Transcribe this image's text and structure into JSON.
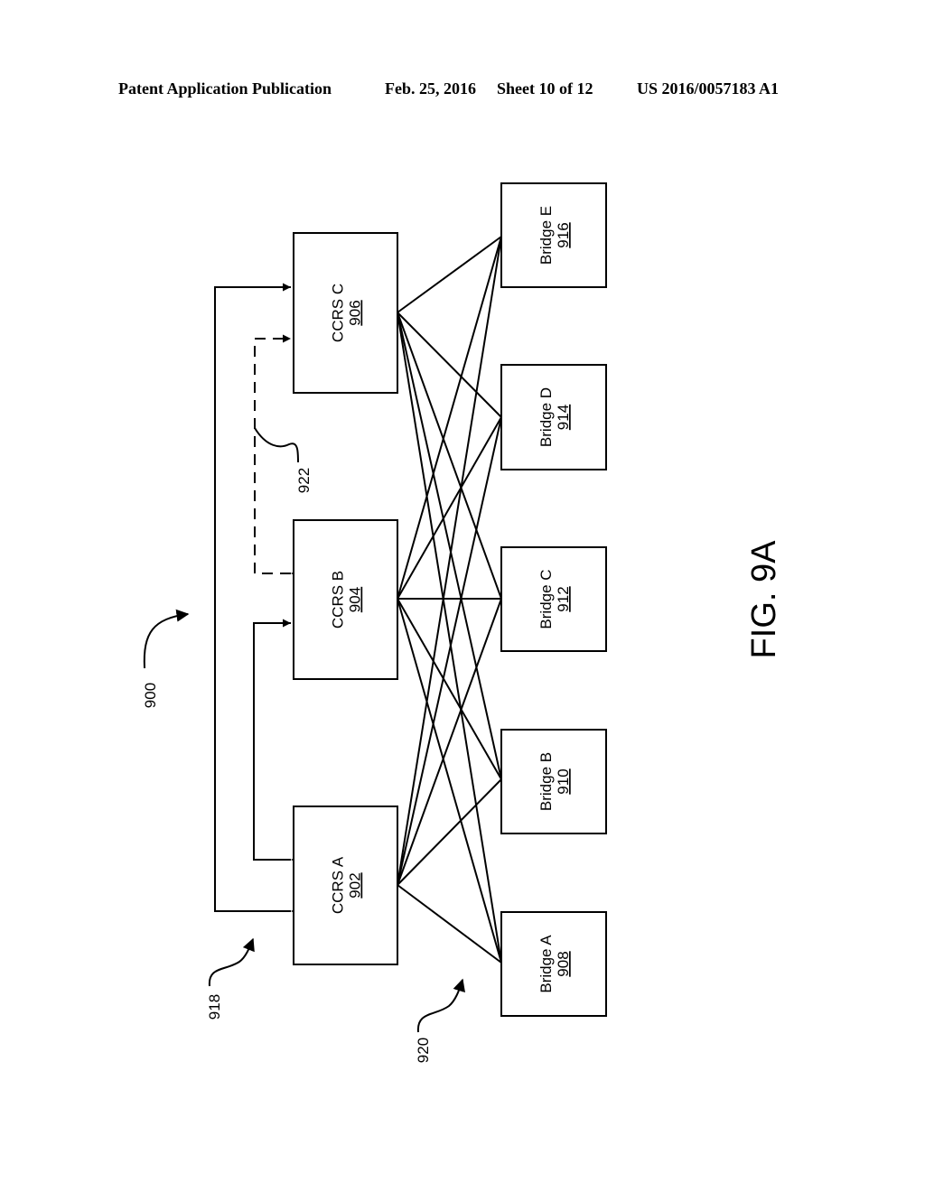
{
  "header": {
    "publication": "Patent Application Publication",
    "date": "Feb. 25, 2016",
    "sheet": "Sheet 10 of 12",
    "number": "US 2016/0057183 A1"
  },
  "figure": {
    "label": "FIG. 9A",
    "system_ref": "900",
    "ccrs_links_ref": "918",
    "bridge_links_ref": "920",
    "dashed_link_ref": "922",
    "ccrs_nodes": [
      {
        "name": "CCRS A",
        "ref": "902"
      },
      {
        "name": "CCRS B",
        "ref": "904"
      },
      {
        "name": "CCRS C",
        "ref": "906"
      }
    ],
    "bridge_nodes": [
      {
        "name": "Bridge A",
        "ref": "908"
      },
      {
        "name": "Bridge B",
        "ref": "910"
      },
      {
        "name": "Bridge C",
        "ref": "912"
      },
      {
        "name": "Bridge D",
        "ref": "914"
      },
      {
        "name": "Bridge E",
        "ref": "916"
      }
    ],
    "mesh": "every CCRS connects to every Bridge",
    "ccrs_links": [
      {
        "from": "CCRS A",
        "to": "CCRS C",
        "style": "solid"
      },
      {
        "from": "CCRS A",
        "to": "CCRS B",
        "style": "solid"
      },
      {
        "from": "CCRS B",
        "to": "CCRS C",
        "style": "dashed"
      }
    ]
  }
}
